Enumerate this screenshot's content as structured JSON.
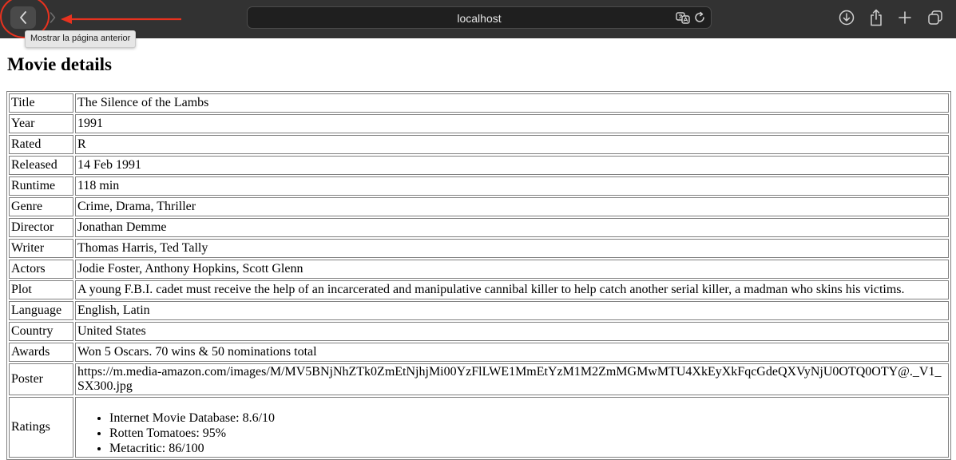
{
  "browser": {
    "address": "localhost",
    "tooltip": "Mostrar la página anterior"
  },
  "page": {
    "title": "Movie details"
  },
  "rows": [
    {
      "label": "Title",
      "value": "The Silence of the Lambs"
    },
    {
      "label": "Year",
      "value": "1991"
    },
    {
      "label": "Rated",
      "value": "R"
    },
    {
      "label": "Released",
      "value": "14 Feb 1991"
    },
    {
      "label": "Runtime",
      "value": "118 min"
    },
    {
      "label": "Genre",
      "value": "Crime, Drama, Thriller"
    },
    {
      "label": "Director",
      "value": "Jonathan Demme"
    },
    {
      "label": "Writer",
      "value": "Thomas Harris, Ted Tally"
    },
    {
      "label": "Actors",
      "value": "Jodie Foster, Anthony Hopkins, Scott Glenn"
    },
    {
      "label": "Plot",
      "value": "A young F.B.I. cadet must receive the help of an incarcerated and manipulative cannibal killer to help catch another serial killer, a madman who skins his victims."
    },
    {
      "label": "Language",
      "value": "English, Latin"
    },
    {
      "label": "Country",
      "value": "United States"
    },
    {
      "label": "Awards",
      "value": "Won 5 Oscars. 70 wins & 50 nominations total"
    },
    {
      "label": "Poster",
      "value": "https://m.media-amazon.com/images/M/MV5BNjNhZTk0ZmEtNjhjMi00YzFlLWE1MmEtYzM1M2ZmMGMwMTU4XkEyXkFqcGdeQXVyNjU0OTQ0OTY@._V1_SX300.jpg"
    }
  ],
  "ratings": {
    "label": "Ratings",
    "items": [
      "Internet Movie Database: 8.6/10",
      "Rotten Tomatoes: 95%",
      "Metacritic: 86/100"
    ]
  },
  "colors": {
    "toolbar": "#323232",
    "annotation": "#e8321f"
  }
}
